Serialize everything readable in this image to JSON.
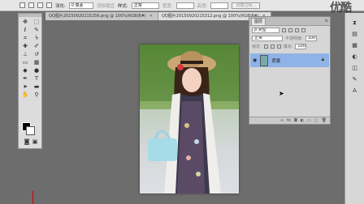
{
  "options_bar": {
    "style_label": "羽化:",
    "style_value": "0 像素",
    "antialias_label": "消除锯齿",
    "mode_label": "样式:",
    "mode_value": "正常",
    "width_label": "宽度:",
    "height_label": "高度:",
    "refine_label": "调整边缘..."
  },
  "logo_text": "优酷",
  "doc_tabs": [
    {
      "label": "QQ图片20150920215256.png @ 100%(RGB/8#)"
    },
    {
      "label": "QQ图片20150920215312.png @ 100%(RGB/8#)"
    }
  ],
  "layers_panel": {
    "tab": "图层",
    "kind_label": "ρ 类型",
    "blend_mode": "正常",
    "opacity_label": "不透明度:",
    "opacity_value": "100%",
    "lock_label": "锁定:",
    "fill_label": "填充:",
    "fill_value": "100%",
    "layer_name": "背景"
  },
  "colors": {
    "fg": "#000000",
    "bg": "#ffffff",
    "selected_layer": "#8fb3e6"
  }
}
